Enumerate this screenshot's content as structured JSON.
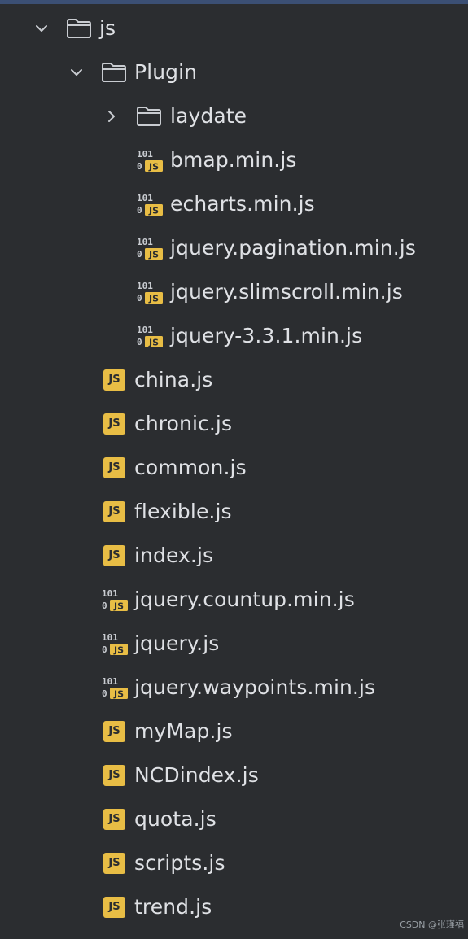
{
  "tree": {
    "js_folder": {
      "label": "js",
      "expanded": true
    },
    "plugin_folder": {
      "label": "Plugin",
      "expanded": true
    },
    "laydate_folder": {
      "label": "laydate",
      "expanded": false
    },
    "plugin_files": [
      {
        "label": "bmap.min.js",
        "icon": "minified-js-icon"
      },
      {
        "label": "echarts.min.js",
        "icon": "minified-js-icon"
      },
      {
        "label": "jquery.pagination.min.js",
        "icon": "minified-js-icon"
      },
      {
        "label": "jquery.slimscroll.min.js",
        "icon": "minified-js-icon"
      },
      {
        "label": "jquery-3.3.1.min.js",
        "icon": "minified-js-icon"
      }
    ],
    "js_files": [
      {
        "label": "china.js",
        "icon": "js-file-icon"
      },
      {
        "label": "chronic.js",
        "icon": "js-file-icon"
      },
      {
        "label": "common.js",
        "icon": "js-file-icon"
      },
      {
        "label": "flexible.js",
        "icon": "js-file-icon"
      },
      {
        "label": "index.js",
        "icon": "js-file-icon"
      },
      {
        "label": "jquery.countup.min.js",
        "icon": "minified-js-icon"
      },
      {
        "label": "jquery.js",
        "icon": "minified-js-icon"
      },
      {
        "label": "jquery.waypoints.min.js",
        "icon": "minified-js-icon"
      },
      {
        "label": "myMap.js",
        "icon": "js-file-icon"
      },
      {
        "label": "NCDindex.js",
        "icon": "js-file-icon"
      },
      {
        "label": "quota.js",
        "icon": "js-file-icon"
      },
      {
        "label": "scripts.js",
        "icon": "js-file-icon"
      },
      {
        "label": "trend.js",
        "icon": "js-file-icon"
      }
    ]
  },
  "icons": {
    "js_badge_text": "JS",
    "min_digits": "101",
    "min_zero": "0"
  },
  "colors": {
    "background": "#2b2d30",
    "text": "#dfe1e5",
    "js_badge": "#e8bd45",
    "chevron": "#c9ccd1",
    "folder_outline": "#c9ccd1"
  },
  "watermark": "CSDN @张瑾福"
}
